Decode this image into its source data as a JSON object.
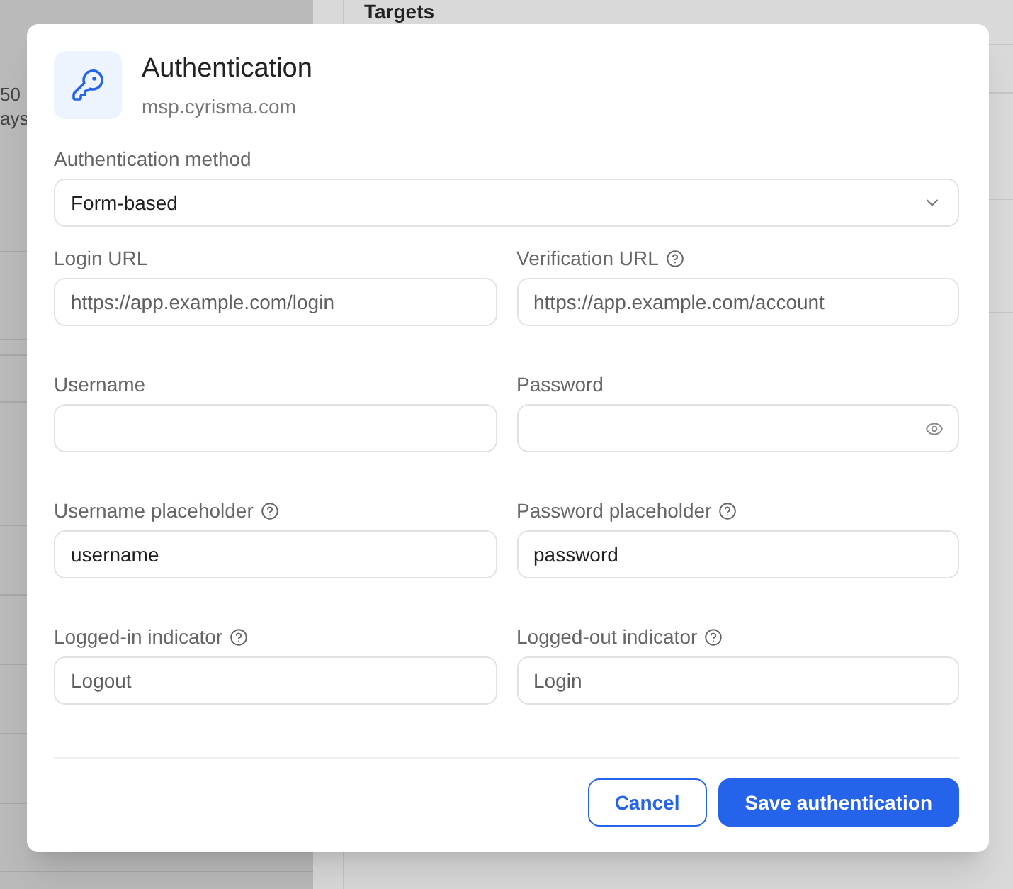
{
  "background": {
    "left_texts": [
      "50",
      "ays"
    ],
    "header": "Targets"
  },
  "dialog": {
    "title": "Authentication",
    "subtitle": "msp.cyrisma.com",
    "method": {
      "label": "Authentication method",
      "value": "Form-based"
    },
    "fields": [
      {
        "label": "Login URL",
        "help": false,
        "kind": "text",
        "placeholder": "https://app.example.com/login"
      },
      {
        "label": "Verification URL",
        "help": true,
        "kind": "text",
        "placeholder": "https://app.example.com/account"
      },
      {
        "label": "Username",
        "help": false,
        "kind": "text"
      },
      {
        "label": "Password",
        "help": false,
        "kind": "password"
      },
      {
        "label": "Username placeholder",
        "help": true,
        "kind": "text",
        "value": "username"
      },
      {
        "label": "Password placeholder",
        "help": true,
        "kind": "text",
        "value": "password"
      },
      {
        "label": "Logged-in indicator",
        "help": true,
        "kind": "text",
        "placeholder": "Logout"
      },
      {
        "label": "Logged-out indicator",
        "help": true,
        "kind": "text",
        "placeholder": "Login"
      }
    ],
    "buttons": [
      {
        "label": "Cancel",
        "kind": "secondary"
      },
      {
        "label": "Save authentication",
        "kind": "primary"
      }
    ]
  }
}
